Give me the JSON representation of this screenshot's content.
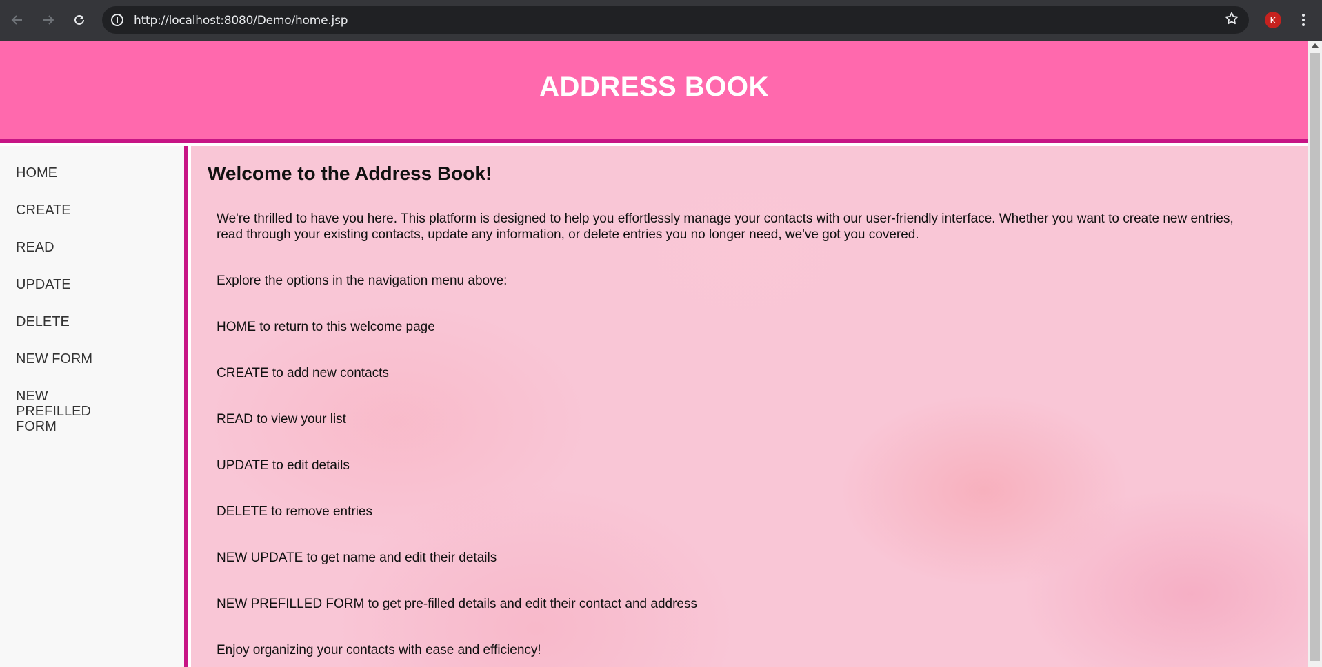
{
  "browser": {
    "url": "http://localhost:8080/Demo/home.jsp",
    "avatar_initial": "K",
    "icons": [
      "back-icon",
      "forward-icon",
      "reload-icon",
      "info-icon",
      "star-icon",
      "more-icon"
    ]
  },
  "header": {
    "title": "ADDRESS BOOK",
    "color": "#ff69ad",
    "border_color": "#c71585"
  },
  "sidebar": {
    "items": [
      {
        "label": "HOME"
      },
      {
        "label": "CREATE"
      },
      {
        "label": "READ"
      },
      {
        "label": "UPDATE"
      },
      {
        "label": "DELETE"
      },
      {
        "label": "NEW FORM"
      },
      {
        "label": "NEW PREFILLED FORM"
      }
    ]
  },
  "main": {
    "heading": "Welcome to the Address Book!",
    "paragraphs": [
      "We're thrilled to have you here. This platform is designed to help you effortlessly manage your contacts with our user-friendly interface. Whether you want to create new entries, read through your existing contacts, update any information, or delete entries you no longer need, we've got you covered.",
      "Explore the options in the navigation menu above:",
      "HOME to return to this welcome page",
      "CREATE to add new contacts",
      "READ to view your list",
      "UPDATE to edit details",
      "DELETE to remove entries",
      "NEW UPDATE to get name and edit their details",
      "NEW PREFILLED FORM to get pre-filled details and edit their contact and address",
      "Enjoy organizing your contacts with ease and efficiency!"
    ]
  }
}
